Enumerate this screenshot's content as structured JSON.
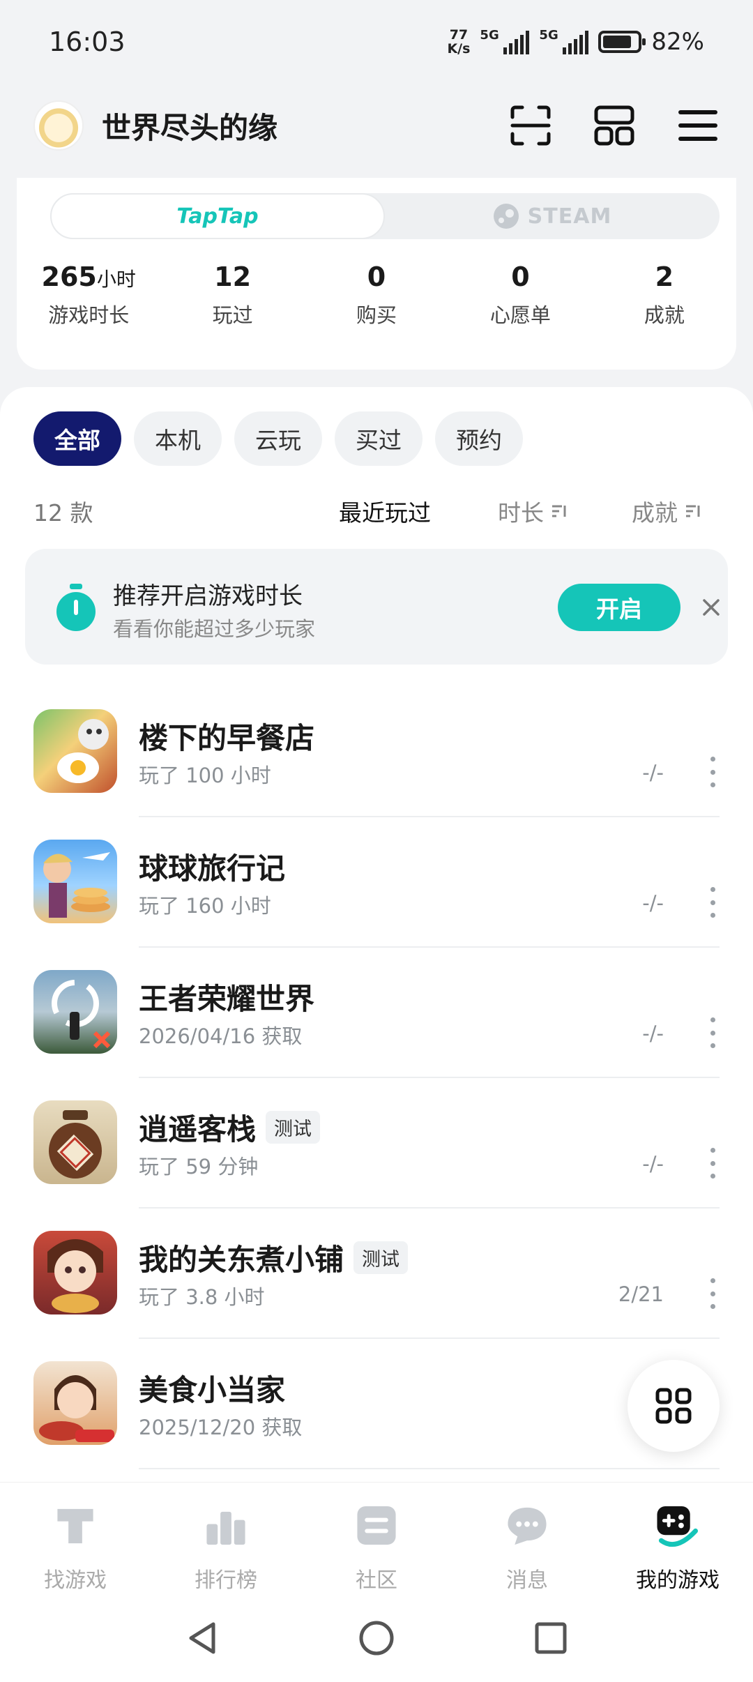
{
  "status_bar": {
    "time": "16:03",
    "net_speed_top": "77",
    "net_speed_bottom": "K/s",
    "sim1": "5G",
    "sim2": "5G",
    "battery": "82%",
    "battery_level": 0.82
  },
  "header": {
    "username": "世界尽头的缘",
    "icons": [
      "scan-icon",
      "layout-icon",
      "menu-icon"
    ]
  },
  "platforms": {
    "tabs": [
      "TapTap",
      "STEAM"
    ],
    "selected": "TapTap"
  },
  "stats": [
    {
      "num": "265",
      "unit": "小时",
      "label": "游戏时长"
    },
    {
      "num": "12",
      "unit": "",
      "label": "玩过"
    },
    {
      "num": "0",
      "unit": "",
      "label": "购买"
    },
    {
      "num": "0",
      "unit": "",
      "label": "心愿单"
    },
    {
      "num": "2",
      "unit": "",
      "label": "成就"
    }
  ],
  "filters": [
    "全部",
    "本机",
    "云玩",
    "买过",
    "预约"
  ],
  "sort": {
    "count": "12 款",
    "recent": "最近玩过",
    "duration": "时长",
    "achievement": "成就"
  },
  "banner": {
    "title": "推荐开启游戏时长",
    "subtitle": "看看你能超过多少玩家",
    "button": "开启"
  },
  "games": [
    {
      "name": "楼下的早餐店",
      "badge": "",
      "sub": "玩了 100 小时",
      "ach": "-/-"
    },
    {
      "name": "球球旅行记",
      "badge": "",
      "sub": "玩了 160 小时",
      "ach": "-/-"
    },
    {
      "name": "王者荣耀世界",
      "badge": "",
      "sub": "2026/04/16 获取",
      "ach": "-/-"
    },
    {
      "name": "逍遥客栈",
      "badge": "测试",
      "sub": "玩了 59 分钟",
      "ach": "-/-"
    },
    {
      "name": "我的关东煮小铺",
      "badge": "测试",
      "sub": "玩了 3.8 小时",
      "ach": "2/21"
    },
    {
      "name": "美食小当家",
      "badge": "",
      "sub": "2025/12/20 获取",
      "ach": ""
    }
  ],
  "nav": [
    "找游戏",
    "排行榜",
    "社区",
    "消息",
    "我的游戏"
  ],
  "colors": {
    "accent": "#15c5b8",
    "chip_active": "#131a6e"
  }
}
